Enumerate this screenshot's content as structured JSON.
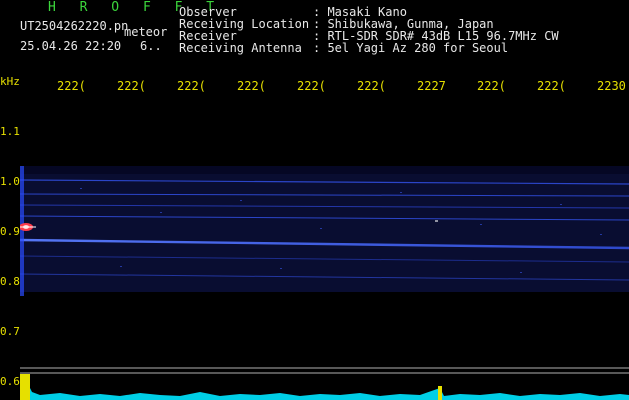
{
  "brand": "H R O F F T",
  "file": {
    "name": "UT2504262220.pn",
    "type": "meteor",
    "datetime": "25.04.26 22:20",
    "extra": "6.."
  },
  "header": {
    "rows": [
      {
        "label": "Observer",
        "value": ": Masaki Kano"
      },
      {
        "label": "Receiving Location",
        "value": ": Shibukawa, Gunma, Japan"
      },
      {
        "label": "Receiver",
        "value": ": RTL-SDR SDR# 43dB L15 96.7MHz CW"
      },
      {
        "label": "Receiving Antenna",
        "value": ": 5el Yagi Az 280 for Seoul"
      }
    ]
  },
  "yaxis": {
    "unit": "kHz",
    "ticks": [
      "1.1",
      "1.0",
      "0.9",
      "0.8",
      "0.7",
      "0.6"
    ]
  },
  "xaxis": {
    "ticks": [
      "222(",
      "222(",
      "222(",
      "222(",
      "222(",
      "222(",
      "2227",
      "222(",
      "222(",
      "2230"
    ]
  },
  "colors": {
    "background": "#000000",
    "axis_text": "#e6e000",
    "brand": "#3cd63c",
    "header_text": "#e8e8e8",
    "signal_main": "#3a5cff",
    "meteor_echo": "#ff3a4a",
    "strip": "#00e5ff"
  }
}
